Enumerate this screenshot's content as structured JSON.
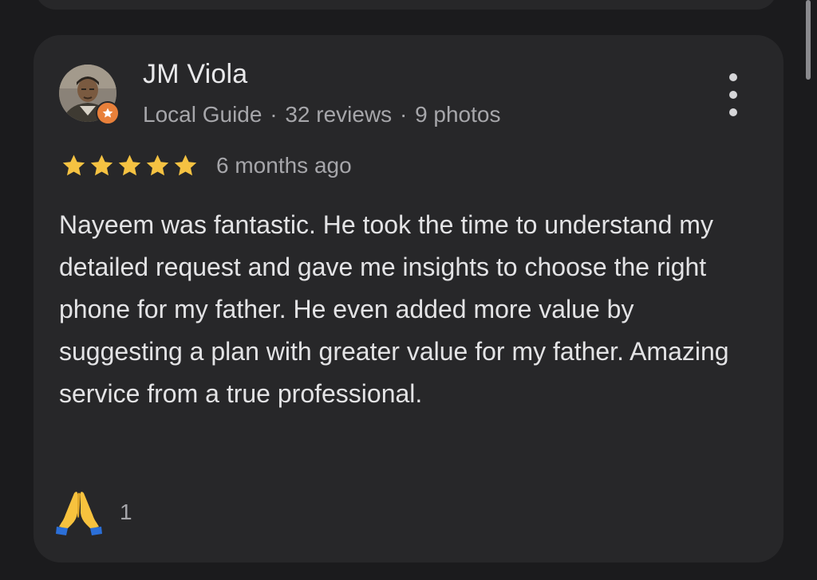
{
  "review": {
    "author": {
      "name": "JM Viola",
      "badge": "Local Guide",
      "separator": "·",
      "reviews": "32 reviews",
      "photos": "9 photos"
    },
    "rating": 5,
    "time": "6 months ago",
    "text": "Nayeem was fantastic. He took the time to understand my detailed request and gave me insights to choose the right phone for my father. He even added more value by suggesting a plan with greater value for my father. Amazing service from a true professional.",
    "reaction": {
      "icon": "folded-hands-icon",
      "count": "1"
    },
    "more_icon": "more-vert-icon"
  },
  "colors": {
    "background": "#1b1b1d",
    "card": "#272729",
    "star": "#f5c242",
    "badge": "#e8803a",
    "primary_text": "#e8e8ea",
    "secondary_text": "#a6a6aa"
  }
}
